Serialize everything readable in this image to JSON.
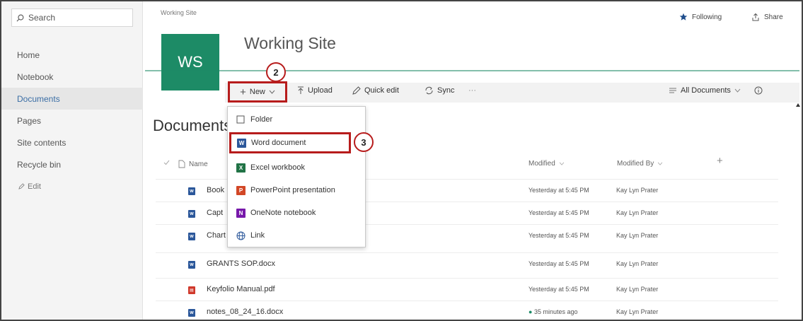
{
  "search": {
    "placeholder": "Search"
  },
  "nav": {
    "items": [
      {
        "label": "Home"
      },
      {
        "label": "Notebook"
      },
      {
        "label": "Documents"
      },
      {
        "label": "Pages"
      },
      {
        "label": "Site contents"
      },
      {
        "label": "Recycle bin"
      }
    ],
    "edit_label": "Edit",
    "active_item": "Documents"
  },
  "header": {
    "breadcrumb": "Working Site",
    "logo_initials": "WS",
    "site_title": "Working Site",
    "following_label": "Following",
    "share_label": "Share"
  },
  "command_bar": {
    "new_label": "New",
    "upload_label": "Upload",
    "quick_edit_label": "Quick edit",
    "sync_label": "Sync",
    "more_label": "···",
    "view_label": "All Documents"
  },
  "main": {
    "title": "Documents",
    "columns": {
      "name": "Name",
      "modified": "Modified",
      "modified_by": "Modified By",
      "add": "+"
    },
    "rows": [
      {
        "name": "Book",
        "modified": "Yesterday at 5:45 PM",
        "modified_by": "Kay Lyn Prater",
        "type": "word"
      },
      {
        "name": "Capt",
        "modified": "Yesterday at 5:45 PM",
        "modified_by": "Kay Lyn Prater",
        "type": "word"
      },
      {
        "name": "Chart",
        "modified": "Yesterday at 5:45 PM",
        "modified_by": "Kay Lyn Prater",
        "type": "word"
      },
      {
        "name": "GRANTS SOP.docx",
        "modified": "Yesterday at 5:45 PM",
        "modified_by": "Kay Lyn Prater",
        "type": "word"
      },
      {
        "name": "Keyfolio Manual.pdf",
        "modified": "Yesterday at 5:45 PM",
        "modified_by": "Kay Lyn Prater",
        "type": "pdf"
      },
      {
        "name": "notes_08_24_16.docx",
        "modified": "35 minutes ago",
        "modified_by": "Kay Lyn Prater",
        "type": "word"
      }
    ]
  },
  "new_menu": {
    "items": [
      {
        "label": "Folder",
        "icon": "folder-icon"
      },
      {
        "label": "Word document",
        "icon": "word-icon"
      },
      {
        "label": "Excel workbook",
        "icon": "excel-icon"
      },
      {
        "label": "PowerPoint presentation",
        "icon": "powerpoint-icon"
      },
      {
        "label": "OneNote notebook",
        "icon": "onenote-icon"
      },
      {
        "label": "Link",
        "icon": "link-icon"
      }
    ]
  },
  "callouts": {
    "new_step": "2",
    "word_step": "3"
  },
  "colors": {
    "brand_green": "#1d8b66",
    "highlight_red": "#b71c1c",
    "word_blue": "#2b579a",
    "excel_green": "#217346",
    "ppt_orange": "#d24726",
    "onenote_purple": "#7719aa",
    "pdf_red": "#d0382b"
  }
}
